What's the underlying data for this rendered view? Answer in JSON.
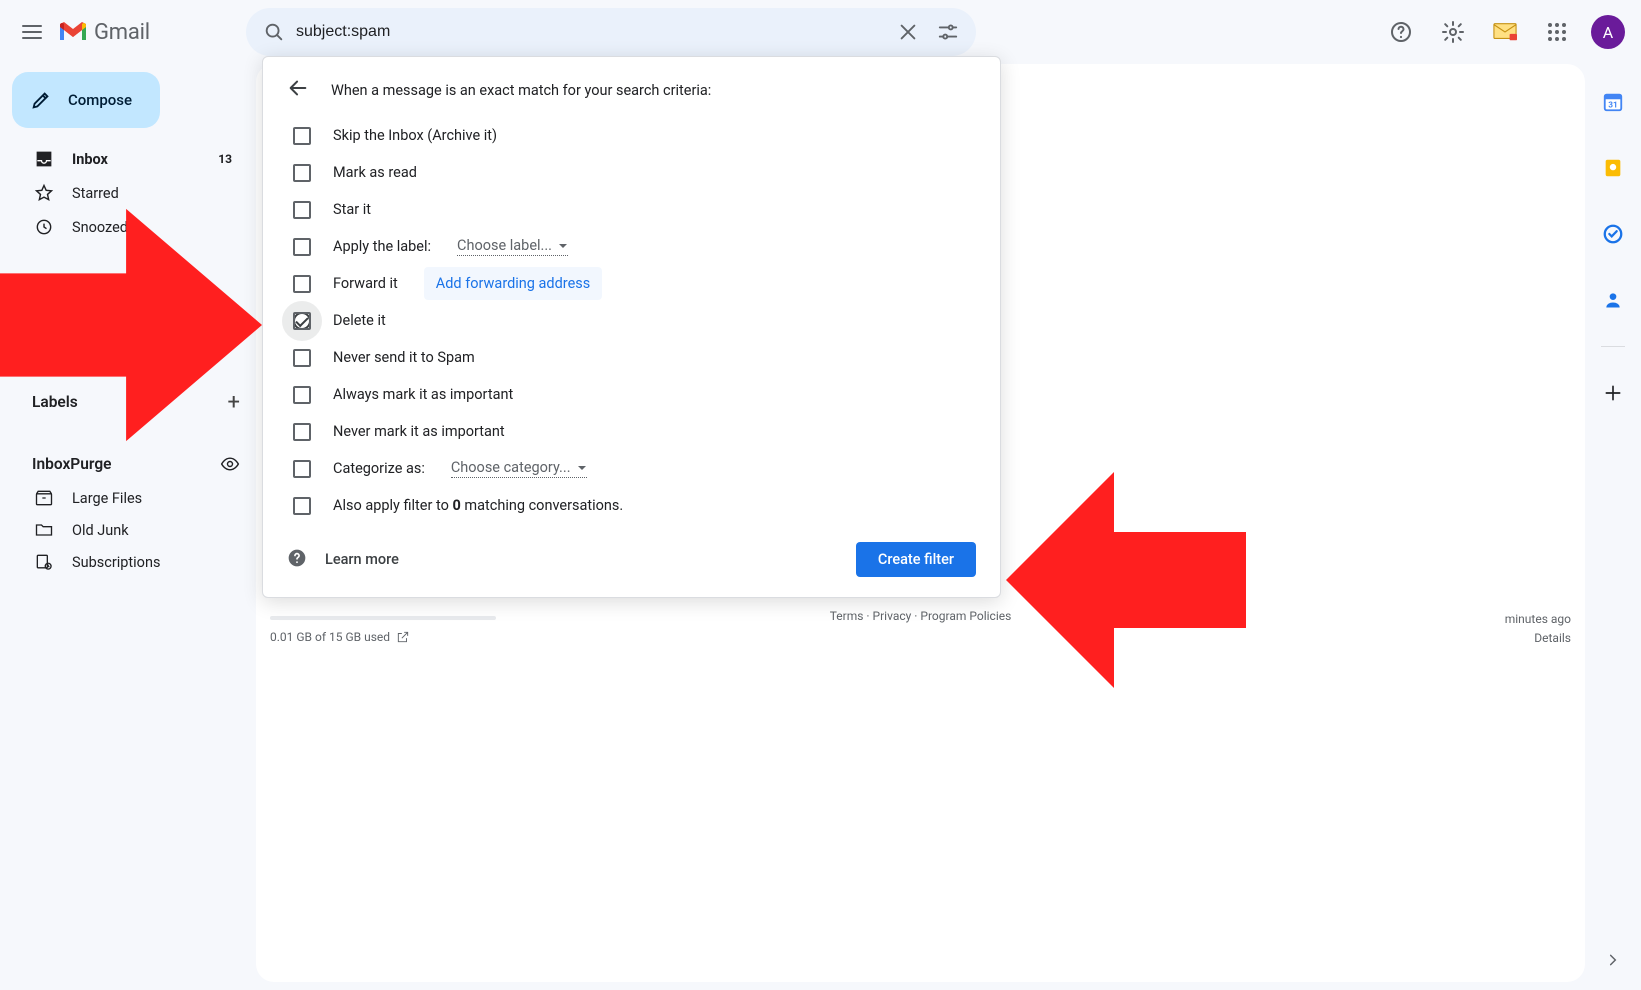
{
  "header": {
    "product": "Gmail",
    "search_value": "subject:spam",
    "avatar_initial": "A"
  },
  "compose_label": "Compose",
  "nav": {
    "inbox": "Inbox",
    "inbox_count": "13",
    "starred": "Starred",
    "snoozed": "Snoozed"
  },
  "sections": {
    "labels_heading": "Labels",
    "inboxpurge_heading": "InboxPurge",
    "large_files": "Large Files",
    "old_junk": "Old Junk",
    "subscriptions": "Subscriptions"
  },
  "filter": {
    "title": "When a message is an exact match for your search criteria:",
    "skip_inbox": "Skip the Inbox (Archive it)",
    "mark_read": "Mark as read",
    "star_it": "Star it",
    "apply_label": "Apply the label:",
    "choose_label": "Choose label...",
    "forward_it": "Forward it",
    "add_fwd": "Add forwarding address",
    "delete_it": "Delete it",
    "never_spam": "Never send it to Spam",
    "always_important": "Always mark it as important",
    "never_important": "Never mark it as important",
    "categorize": "Categorize as:",
    "choose_category": "Choose category...",
    "also_apply_pre": "Also apply filter to ",
    "also_apply_count": "0",
    "also_apply_post": " matching conversations.",
    "learn_more": "Learn more",
    "create": "Create filter"
  },
  "footer": {
    "storage": "0.01 GB of 15 GB used",
    "terms": "Terms",
    "privacy": "Privacy",
    "policies": "Program Policies",
    "activity": "minutes ago",
    "details": "Details"
  }
}
